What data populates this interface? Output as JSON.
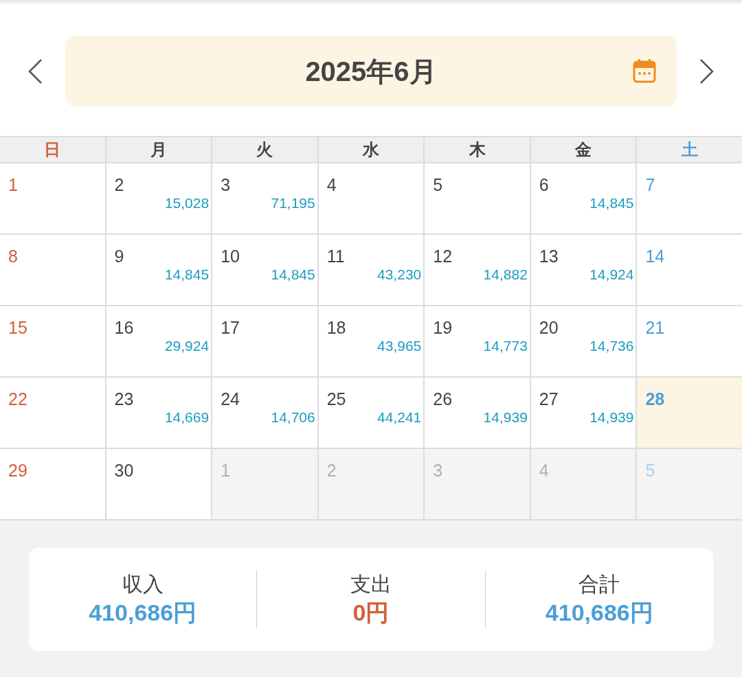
{
  "header": {
    "title": "2025年6月"
  },
  "weekdays": [
    {
      "label": "日",
      "kind": "sunday"
    },
    {
      "label": "月",
      "kind": "weekday"
    },
    {
      "label": "火",
      "kind": "weekday"
    },
    {
      "label": "水",
      "kind": "weekday"
    },
    {
      "label": "木",
      "kind": "weekday"
    },
    {
      "label": "金",
      "kind": "weekday"
    },
    {
      "label": "土",
      "kind": "saturday"
    }
  ],
  "weeks": [
    [
      {
        "day": "1",
        "muted": false,
        "today": false
      },
      {
        "day": "2",
        "amount": "15,028",
        "muted": false,
        "today": false
      },
      {
        "day": "3",
        "amount": "71,195",
        "muted": false,
        "today": false
      },
      {
        "day": "4",
        "muted": false,
        "today": false
      },
      {
        "day": "5",
        "muted": false,
        "today": false
      },
      {
        "day": "6",
        "amount": "14,845",
        "muted": false,
        "today": false
      },
      {
        "day": "7",
        "muted": false,
        "today": false
      }
    ],
    [
      {
        "day": "8",
        "muted": false,
        "today": false
      },
      {
        "day": "9",
        "amount": "14,845",
        "muted": false,
        "today": false
      },
      {
        "day": "10",
        "amount": "14,845",
        "muted": false,
        "today": false
      },
      {
        "day": "11",
        "amount": "43,230",
        "muted": false,
        "today": false
      },
      {
        "day": "12",
        "amount": "14,882",
        "muted": false,
        "today": false
      },
      {
        "day": "13",
        "amount": "14,924",
        "muted": false,
        "today": false
      },
      {
        "day": "14",
        "muted": false,
        "today": false
      }
    ],
    [
      {
        "day": "15",
        "muted": false,
        "today": false
      },
      {
        "day": "16",
        "amount": "29,924",
        "muted": false,
        "today": false
      },
      {
        "day": "17",
        "muted": false,
        "today": false
      },
      {
        "day": "18",
        "amount": "43,965",
        "muted": false,
        "today": false
      },
      {
        "day": "19",
        "amount": "14,773",
        "muted": false,
        "today": false
      },
      {
        "day": "20",
        "amount": "14,736",
        "muted": false,
        "today": false
      },
      {
        "day": "21",
        "muted": false,
        "today": false
      }
    ],
    [
      {
        "day": "22",
        "muted": false,
        "today": false
      },
      {
        "day": "23",
        "amount": "14,669",
        "muted": false,
        "today": false
      },
      {
        "day": "24",
        "amount": "14,706",
        "muted": false,
        "today": false
      },
      {
        "day": "25",
        "amount": "44,241",
        "muted": false,
        "today": false
      },
      {
        "day": "26",
        "amount": "14,939",
        "muted": false,
        "today": false
      },
      {
        "day": "27",
        "amount": "14,939",
        "muted": false,
        "today": false
      },
      {
        "day": "28",
        "muted": false,
        "today": true
      }
    ],
    [
      {
        "day": "29",
        "muted": false,
        "today": false
      },
      {
        "day": "30",
        "muted": false,
        "today": false
      },
      {
        "day": "1",
        "muted": true,
        "today": false
      },
      {
        "day": "2",
        "muted": true,
        "today": false
      },
      {
        "day": "3",
        "muted": true,
        "today": false
      },
      {
        "day": "4",
        "muted": true,
        "today": false
      },
      {
        "day": "5",
        "muted": true,
        "today": false
      }
    ]
  ],
  "summary": [
    {
      "label": "収入",
      "value": "410,686円",
      "kind": "income"
    },
    {
      "label": "支出",
      "value": "0円",
      "kind": "expense"
    },
    {
      "label": "合計",
      "value": "410,686円",
      "kind": "total"
    }
  ]
}
